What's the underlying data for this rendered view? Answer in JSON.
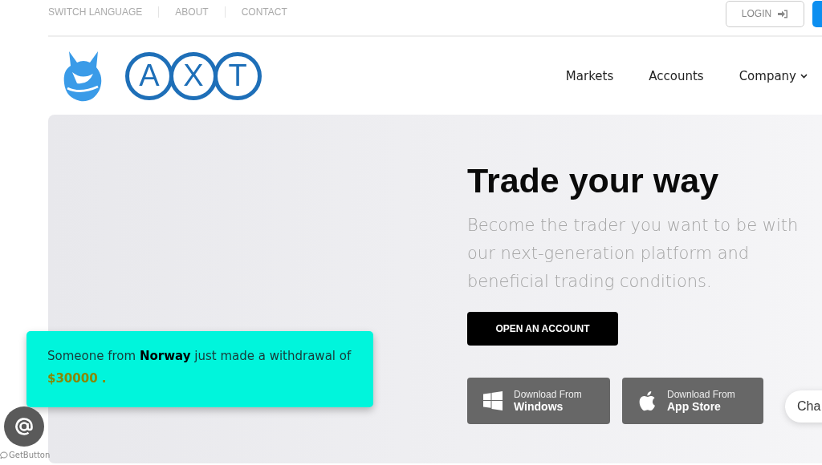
{
  "top_bar": {
    "links": [
      "SWITCH LANGUAGE",
      "ABOUT",
      "CONTACT"
    ],
    "login": {
      "label": "LOGIN"
    }
  },
  "logo": {
    "letters": [
      "A",
      "X",
      "T"
    ]
  },
  "nav": [
    {
      "label": "Markets",
      "dropdown": false
    },
    {
      "label": "Accounts",
      "dropdown": false
    },
    {
      "label": "Company",
      "dropdown": true
    }
  ],
  "hero": {
    "title": "Trade your way",
    "subtitle": "Become the trader you want to be with our next-generation platform and beneficial trading conditions.",
    "cta": "OPEN AN ACCOUNT",
    "downloads": [
      {
        "kind": "windows",
        "caption": "Download From",
        "store": "Windows"
      },
      {
        "kind": "apple",
        "caption": "Download From",
        "store": "App Store"
      }
    ]
  },
  "notification": {
    "message": "Someone from **Norway** just made a withdrawal of",
    "amount": "$30000 ."
  },
  "contact_widget": {
    "credit": "GetButton"
  },
  "chat_button": {
    "label": "Cha"
  }
}
